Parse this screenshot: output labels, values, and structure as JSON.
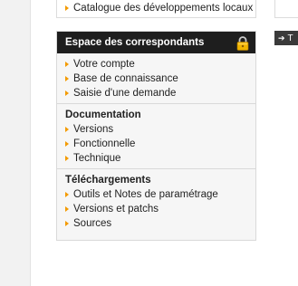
{
  "top_link": {
    "label": "Catalogue des développements locaux"
  },
  "right_tab": {
    "label": "T"
  },
  "panel": {
    "title": "Espace des correspondants",
    "lock_icon": "lock-icon",
    "accent_color": "#f39a00",
    "sections": [
      {
        "title": "",
        "items": [
          {
            "label": "Votre compte"
          },
          {
            "label": "Base de connaissance"
          },
          {
            "label": "Saisie d'une demande"
          }
        ]
      },
      {
        "title": "Documentation",
        "items": [
          {
            "label": "Versions"
          },
          {
            "label": "Fonctionnelle"
          },
          {
            "label": "Technique"
          }
        ]
      },
      {
        "title": "Téléchargements",
        "items": [
          {
            "label": "Outils et Notes de paramétrage"
          },
          {
            "label": "Versions et patchs"
          },
          {
            "label": "Sources"
          }
        ]
      }
    ]
  }
}
